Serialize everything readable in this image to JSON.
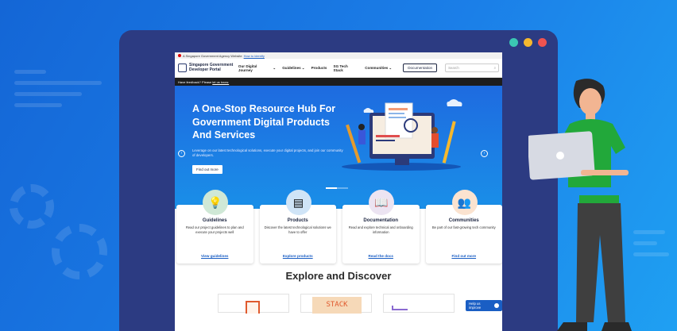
{
  "colors": {
    "accent": "#1a5ec4",
    "navy": "#2c3b82",
    "window_dot_1": "#3bc7b3",
    "window_dot_2": "#f5b82e",
    "window_dot_3": "#ef5350",
    "shirt": "#22a83a"
  },
  "gov_bar": {
    "text": "A Singapore Government Agency Website",
    "link": "How to identify"
  },
  "header": {
    "logo_line1": "Singapore Government",
    "logo_line2": "Developer Portal",
    "menu": [
      {
        "label": "Our Digital Journey",
        "dropdown": true
      },
      {
        "label": "Guidelines",
        "dropdown": true
      },
      {
        "label": "Products",
        "dropdown": false
      },
      {
        "label": "SG Tech Stack",
        "dropdown": false
      },
      {
        "label": "Communities",
        "dropdown": true
      }
    ],
    "documentation_button": "Documentation",
    "search_placeholder": "Search"
  },
  "feedback": {
    "text": "Have feedback? Please",
    "link": "let us know."
  },
  "hero": {
    "title": "A One-Stop Resource Hub For Government Digital Products And Services",
    "description": "Leverage on our latest technological solutions, execute your digital projects, and join our community of developers.",
    "button": "Find out more"
  },
  "cards": [
    {
      "title": "Guidelines",
      "description": "Read our project guidelines to plan and execute your projects well",
      "link": "View guidelines",
      "icon": "lightbulb-gear-icon",
      "bg": "#cfe8d6"
    },
    {
      "title": "Products",
      "description": "Discover the latest technological solutions we have to offer",
      "link": "Explore products",
      "icon": "server-stack-icon",
      "bg": "#cfe4f7"
    },
    {
      "title": "Documentation",
      "description": "Read and explore technical and onboarding information",
      "link": "Read the docs",
      "icon": "open-book-icon",
      "bg": "#ece4f2"
    },
    {
      "title": "Communities",
      "description": "Be part of our fast-growing tech community",
      "link": "Find out more",
      "icon": "people-chat-icon",
      "bg": "#fbe3d0"
    }
  ],
  "explore_title": "Explore and Discover",
  "thumb_labels": [
    "STACK"
  ],
  "help_button": "Help us improve"
}
